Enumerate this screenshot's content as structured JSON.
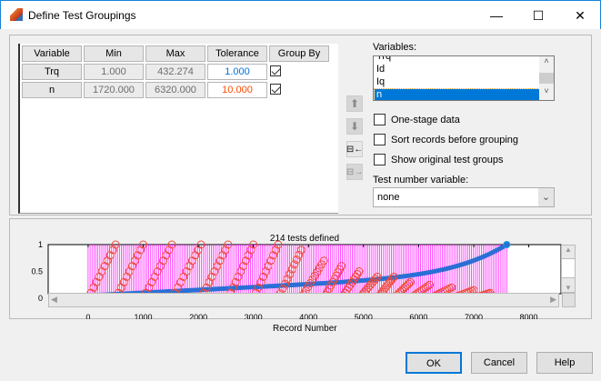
{
  "window": {
    "title": "Define Test Groupings",
    "minimize": "—",
    "maximize": "☐",
    "close": "✕"
  },
  "table": {
    "headers": [
      "Variable",
      "Min",
      "Max",
      "Tolerance",
      "Group By"
    ],
    "rows": [
      {
        "variable": "Trq",
        "min": "1.000",
        "max": "432.274",
        "tolerance": "1.000",
        "tolerance_color": "#0072d6",
        "group_by": true
      },
      {
        "variable": "n",
        "min": "1720.000",
        "max": "6320.000",
        "tolerance": "10.000",
        "tolerance_color": "#ff4b00",
        "group_by": true
      }
    ]
  },
  "variables": {
    "label": "Variables:",
    "items": [
      "Trq",
      "Id",
      "Iq",
      "n"
    ],
    "selected": "n"
  },
  "options": [
    {
      "label": "One-stage data",
      "checked": false
    },
    {
      "label": "Sort records before grouping",
      "checked": false
    },
    {
      "label": "Show original test groups",
      "checked": false
    }
  ],
  "test_number": {
    "label": "Test number variable:",
    "value": "none"
  },
  "buttons": {
    "ok": "OK",
    "cancel": "Cancel",
    "help": "Help"
  },
  "chart_data": {
    "type": "scatter",
    "title": "214 tests defined",
    "xlabel": "Record Number",
    "ylabel": "",
    "xlim": [
      -725,
      8585
    ],
    "ylim": [
      0,
      1
    ],
    "xticks": [
      "0",
      "1000",
      "2000",
      "3000",
      "4000",
      "5000",
      "6000",
      "7000",
      "8000"
    ],
    "xtick_values": [
      0,
      1000,
      2000,
      3000,
      4000,
      5000,
      6000,
      7000,
      8000
    ],
    "yticks": [
      "0",
      "0.5",
      "1"
    ],
    "ytick_values": [
      0,
      0.5,
      1
    ],
    "tests_defined": 214,
    "record_range": [
      0,
      7600
    ],
    "group_ramps": [
      {
        "start": 0,
        "end": 500,
        "peak": 1.0
      },
      {
        "start": 500,
        "end": 1000,
        "peak": 1.0
      },
      {
        "start": 1000,
        "end": 1520,
        "peak": 1.0
      },
      {
        "start": 1520,
        "end": 2050,
        "peak": 1.0
      },
      {
        "start": 2050,
        "end": 2540,
        "peak": 1.0
      },
      {
        "start": 2540,
        "end": 3000,
        "peak": 1.0
      },
      {
        "start": 3000,
        "end": 3450,
        "peak": 1.0
      },
      {
        "start": 3450,
        "end": 3870,
        "peak": 0.9
      },
      {
        "start": 3870,
        "end": 4280,
        "peak": 0.7
      },
      {
        "start": 4280,
        "end": 4600,
        "peak": 0.6
      },
      {
        "start": 4600,
        "end": 4920,
        "peak": 0.5
      },
      {
        "start": 4920,
        "end": 5250,
        "peak": 0.4
      },
      {
        "start": 5250,
        "end": 5550,
        "peak": 0.4
      },
      {
        "start": 5550,
        "end": 5850,
        "peak": 0.3
      },
      {
        "start": 5850,
        "end": 6200,
        "peak": 0.25
      },
      {
        "start": 6200,
        "end": 6600,
        "peak": 0.2
      },
      {
        "start": 6600,
        "end": 7000,
        "peak": 0.15
      },
      {
        "start": 7000,
        "end": 7300,
        "peak": 0.1
      }
    ],
    "sorted_series_color": "#2b6fd6",
    "group_color": "#f04a3a",
    "boundary_color": "#ff00ff"
  }
}
